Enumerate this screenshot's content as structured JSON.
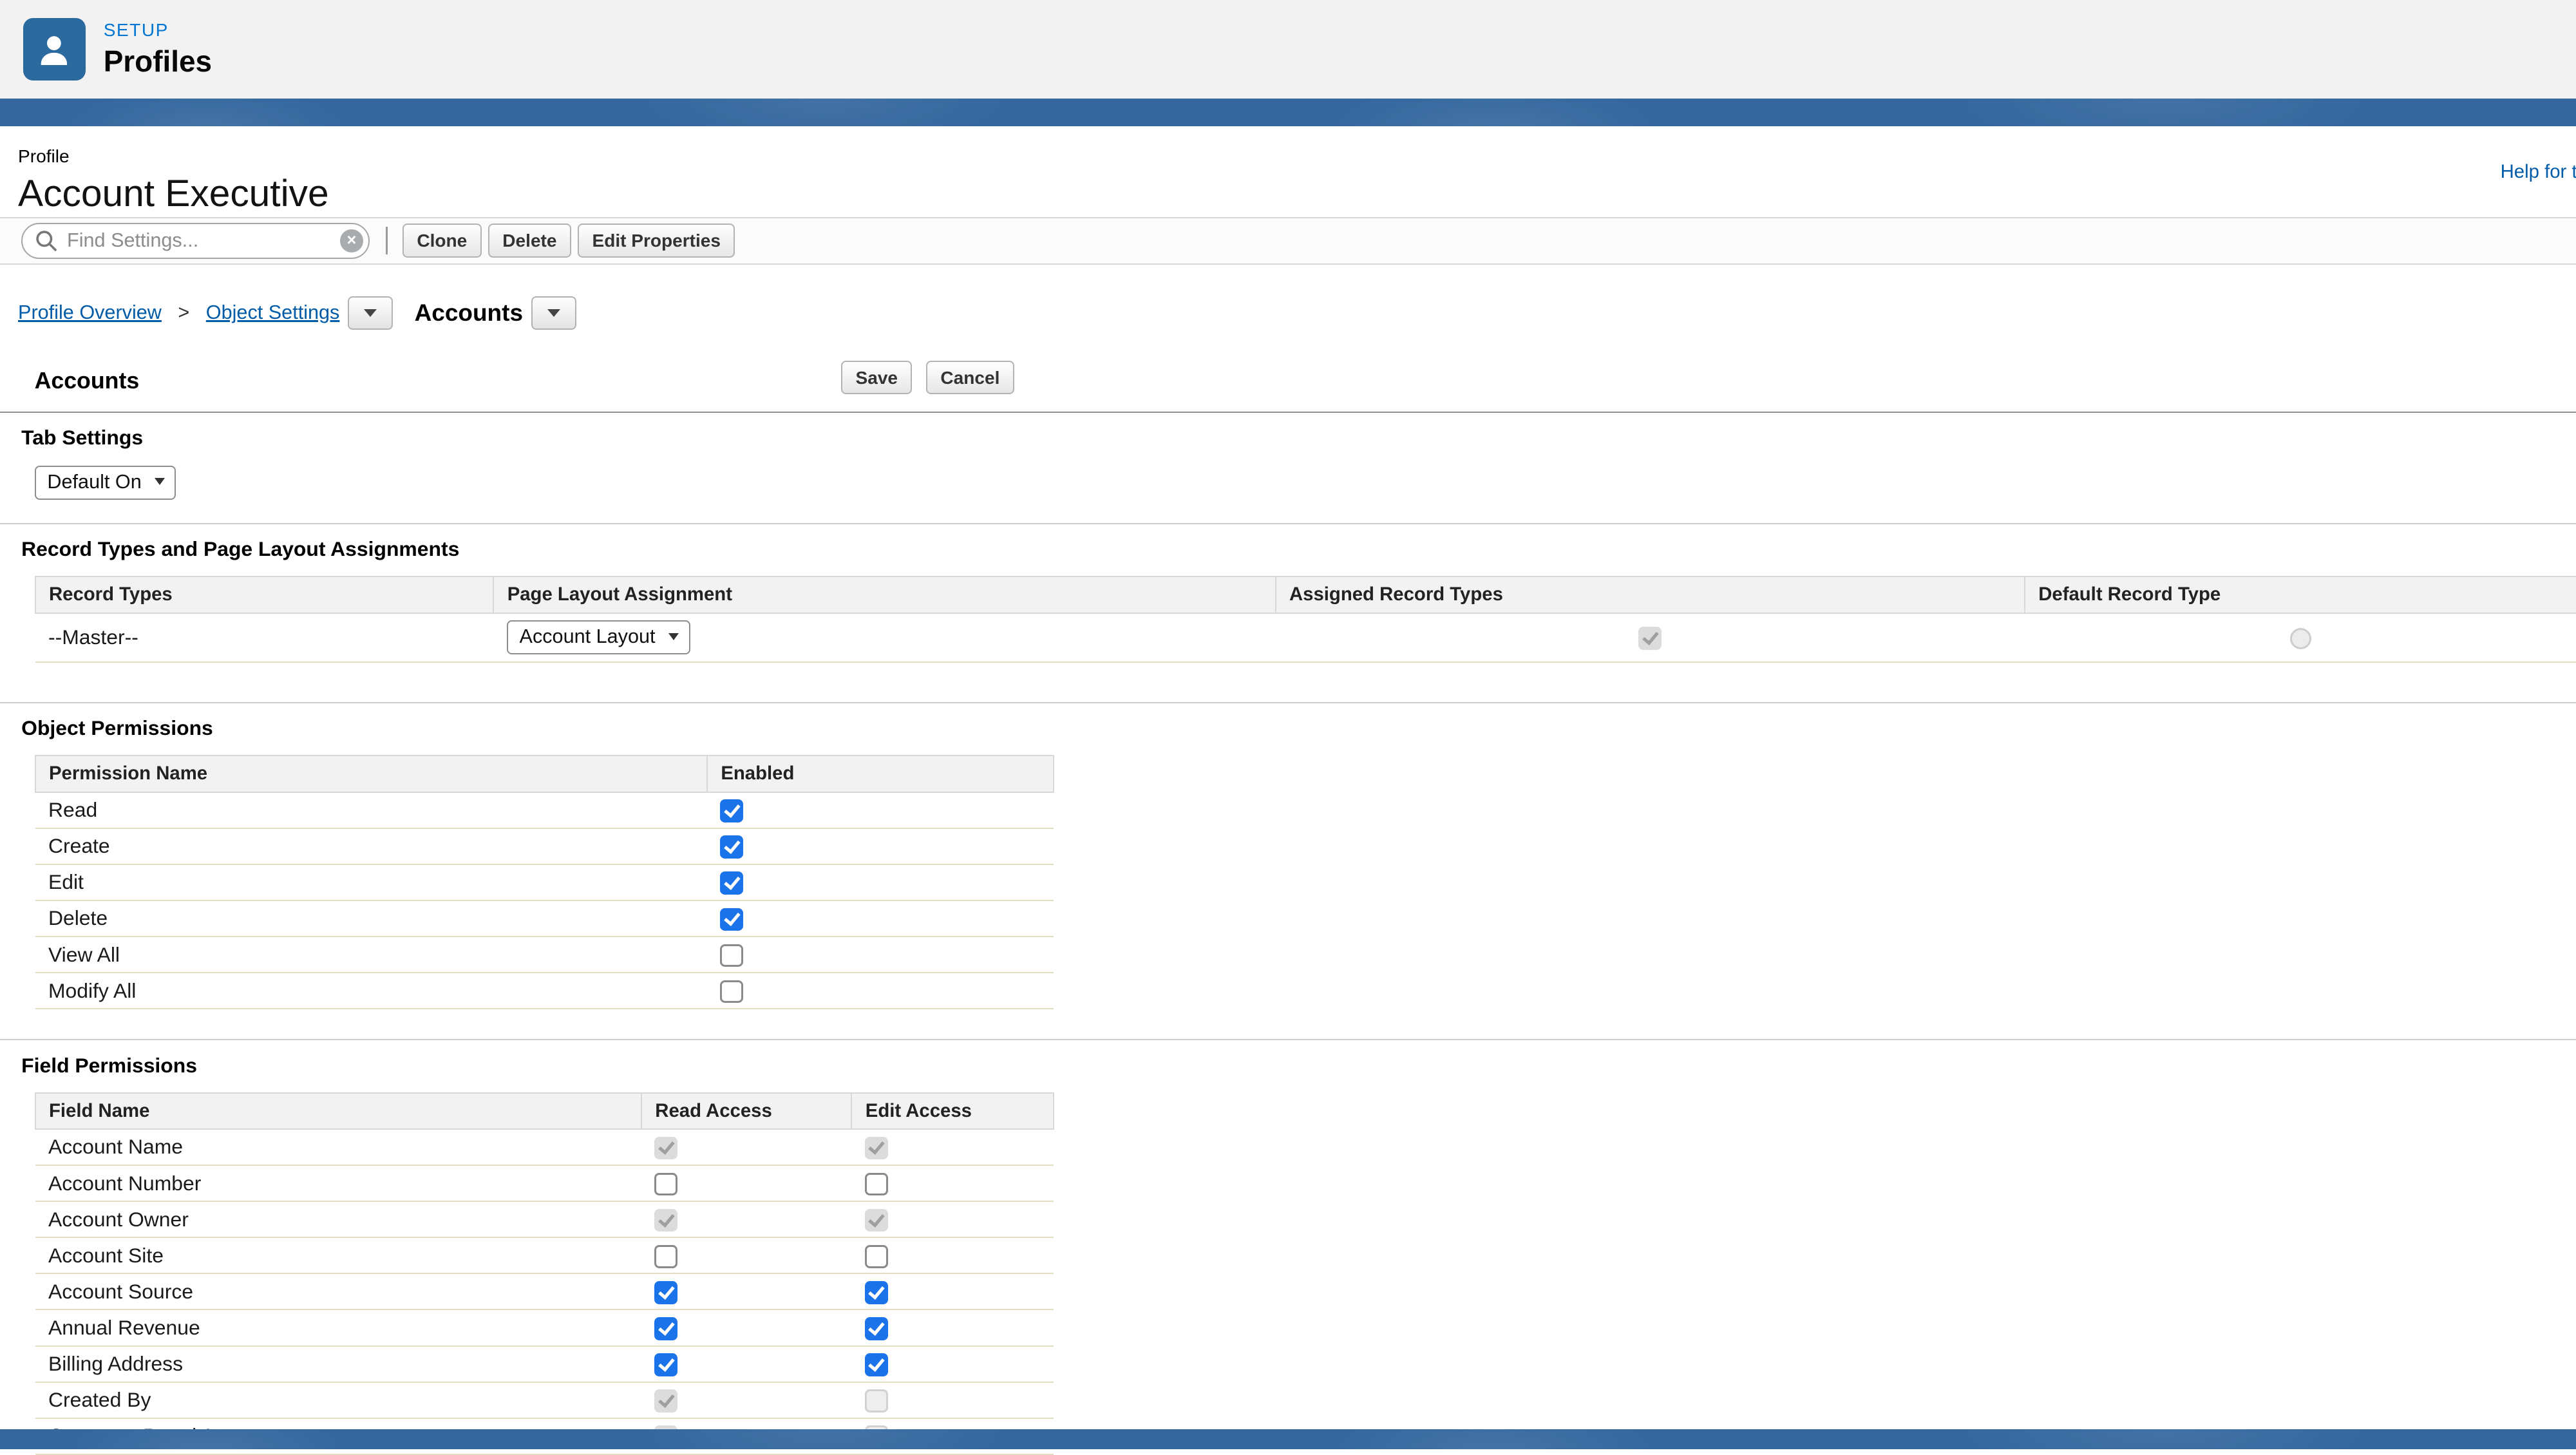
{
  "colors": {
    "brand_blue": "#0176d3",
    "banner_blue": "#35689f",
    "checkbox_blue": "#1a73e8",
    "link_blue": "#015ba7",
    "setup_icon_bg": "#2b6a9f"
  },
  "icons": {
    "setup": "person-icon",
    "search": "magnifier-icon",
    "clear": "circle-x-icon",
    "dropdown": "triangle-down-icon"
  },
  "header": {
    "setup_label": "SETUP",
    "app_title": "Profiles"
  },
  "page": {
    "entity_label": "Profile",
    "title": "Account Executive",
    "help_link": "Help for this Page"
  },
  "toolbar": {
    "search_placeholder": "Find Settings...",
    "clear_glyph": "×",
    "clone": "Clone",
    "delete": "Delete",
    "edit_properties": "Edit Properties"
  },
  "breadcrumb": {
    "overview": "Profile Overview",
    "separator": ">",
    "object_settings": "Object Settings",
    "current": "Accounts"
  },
  "section": {
    "title": "Accounts",
    "save": "Save",
    "cancel": "Cancel"
  },
  "tab_settings": {
    "title": "Tab Settings",
    "selected": "Default On"
  },
  "record_types": {
    "title": "Record Types and Page Layout Assignments",
    "columns": [
      "Record Types",
      "Page Layout Assignment",
      "Assigned Record Types",
      "Default Record Type"
    ],
    "rows": [
      {
        "record_type": "--Master--",
        "page_layout": "Account Layout",
        "assigned_checked": true,
        "default_selected": false
      }
    ]
  },
  "object_permissions": {
    "title": "Object Permissions",
    "columns": [
      "Permission Name",
      "Enabled"
    ],
    "rows": [
      {
        "name": "Read",
        "enabled": true
      },
      {
        "name": "Create",
        "enabled": true
      },
      {
        "name": "Edit",
        "enabled": true
      },
      {
        "name": "Delete",
        "enabled": true
      },
      {
        "name": "View All",
        "enabled": false
      },
      {
        "name": "Modify All",
        "enabled": false
      }
    ]
  },
  "field_permissions": {
    "title": "Field Permissions",
    "columns": [
      "Field Name",
      "Read Access",
      "Edit Access"
    ],
    "rows": [
      {
        "name": "Account Name",
        "read": "disabled-checked",
        "edit": "disabled-checked"
      },
      {
        "name": "Account Number",
        "read": "unchecked",
        "edit": "unchecked"
      },
      {
        "name": "Account Owner",
        "read": "disabled-checked",
        "edit": "disabled-checked"
      },
      {
        "name": "Account Site",
        "read": "unchecked",
        "edit": "unchecked"
      },
      {
        "name": "Account Source",
        "read": "checked",
        "edit": "checked"
      },
      {
        "name": "Annual Revenue",
        "read": "checked",
        "edit": "checked"
      },
      {
        "name": "Billing Address",
        "read": "checked",
        "edit": "checked"
      },
      {
        "name": "Created By",
        "read": "disabled-checked",
        "edit": "disabled-unchecked"
      },
      {
        "name": "Customer Portal Account",
        "read": "disabled-checked",
        "edit": "disabled-unchecked"
      }
    ]
  }
}
